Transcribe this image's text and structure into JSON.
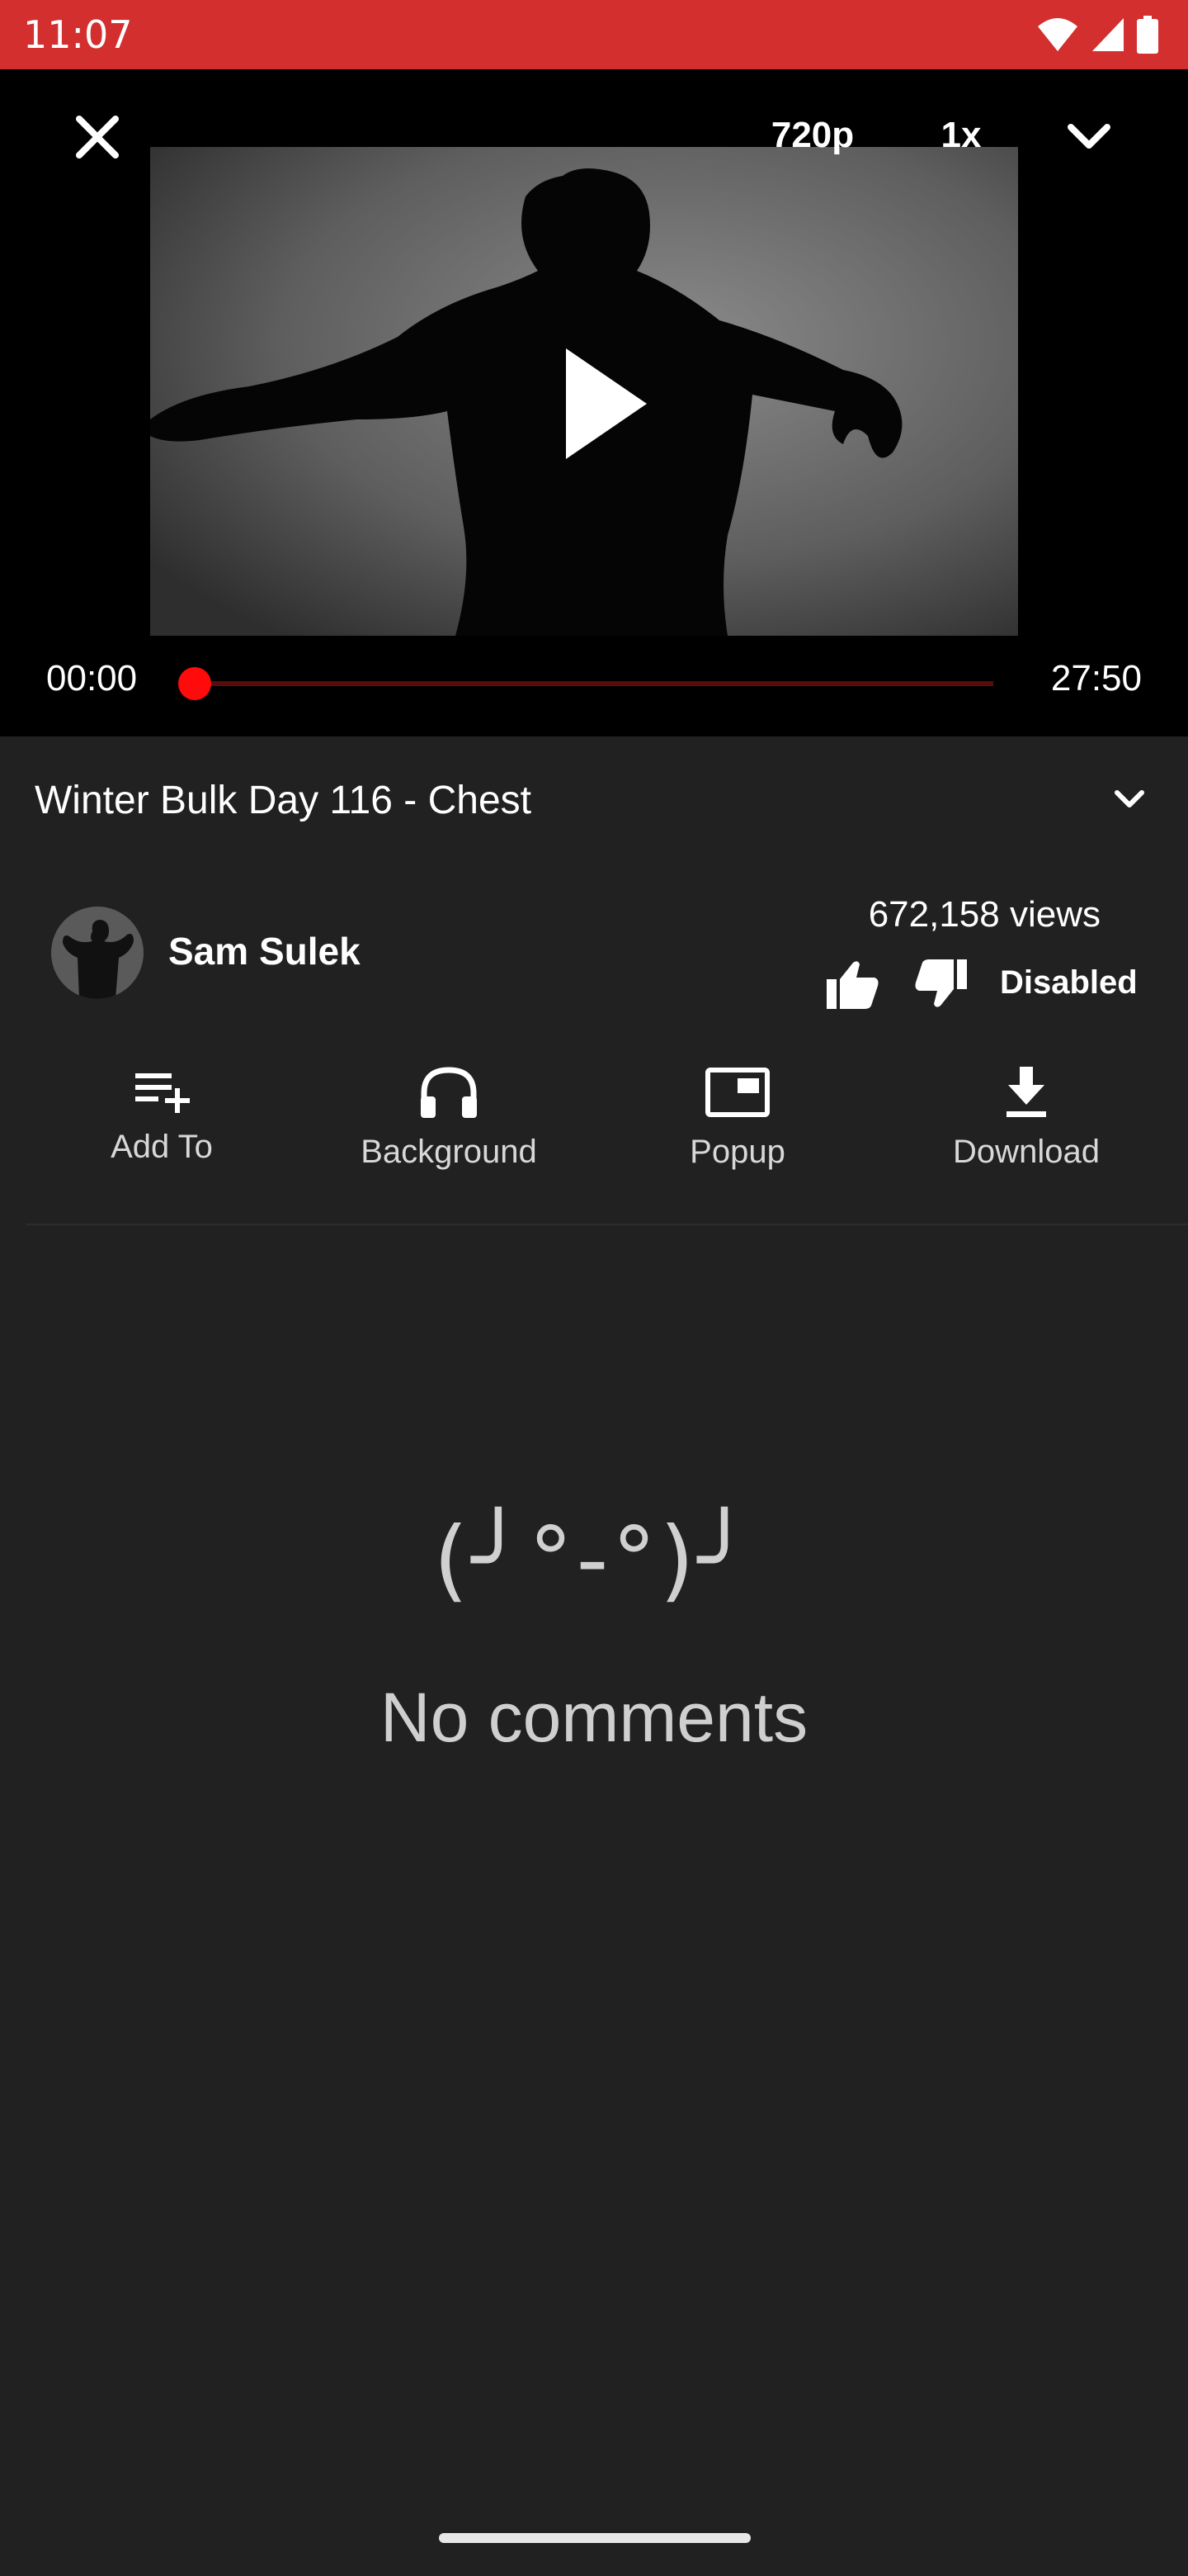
{
  "status_bar": {
    "time": "11:07",
    "background": "#d32f2f",
    "icons": [
      "wifi-icon",
      "cellular-signal-icon",
      "battery-icon"
    ]
  },
  "player": {
    "quality": "720p",
    "speed": "1x",
    "time_current": "00:00",
    "time_total": "27:50",
    "progress": 0,
    "accent_color": "#ff0b0b",
    "icons": [
      "close-icon",
      "chevron-down-icon",
      "play-icon"
    ]
  },
  "video": {
    "title": "Winter Bulk Day 116 - Chest",
    "expand_icon": "chevron-down-icon"
  },
  "channel": {
    "name": "Sam Sulek",
    "avatar_icon": "avatar"
  },
  "stats": {
    "views": "672,158 views",
    "like_icon": "thumb-up-icon",
    "dislike_icon": "thumb-down-icon",
    "dislikes_label": "Disabled"
  },
  "actions": [
    {
      "label": "Add To",
      "icon": "playlist-add-icon"
    },
    {
      "label": "Background",
      "icon": "headphones-icon"
    },
    {
      "label": "Popup",
      "icon": "picture-in-picture-icon"
    },
    {
      "label": "Download",
      "icon": "download-icon"
    }
  ],
  "comments": {
    "emoticon": "(╯°-°)╯",
    "message": "No comments"
  }
}
